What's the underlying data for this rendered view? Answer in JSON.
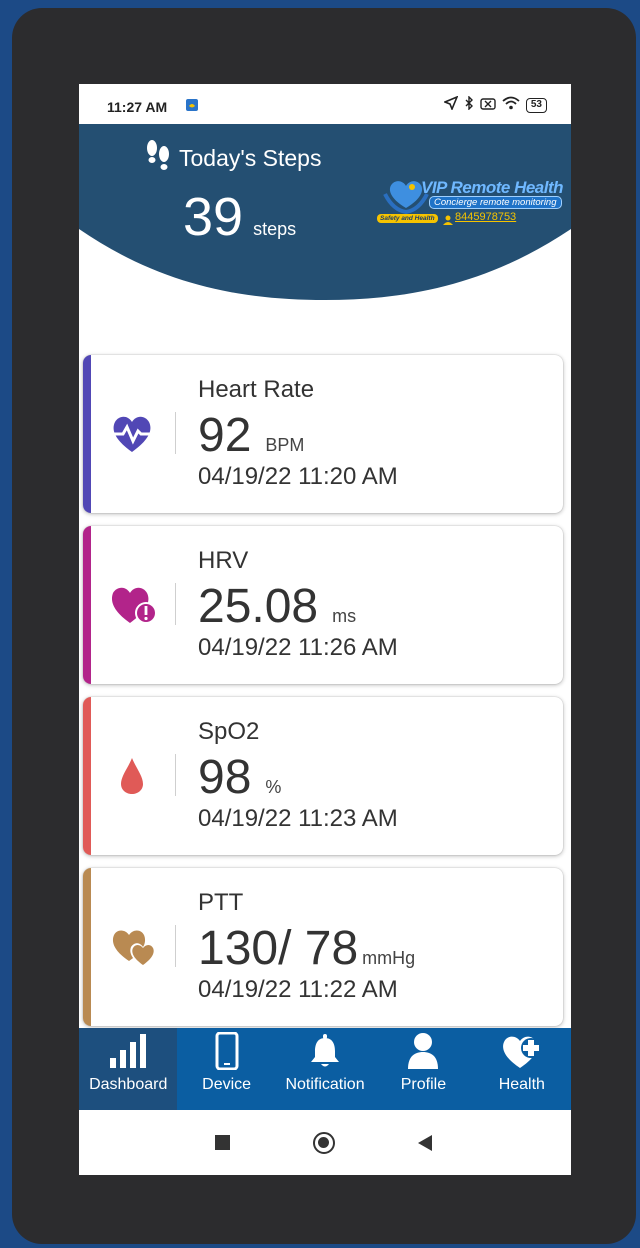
{
  "status_bar": {
    "time": "11:27 AM",
    "battery": "53"
  },
  "header": {
    "steps_title": "Today's Steps",
    "steps_value": "39",
    "steps_unit": "steps",
    "colors": {
      "header_bg": "#244f72"
    }
  },
  "logo": {
    "title": "VIP Remote Health",
    "subtitle": "Concierge remote monitoring",
    "tagline": "Safety and Health",
    "phone": "8445978753"
  },
  "cards": [
    {
      "name": "Heart Rate",
      "value": "92",
      "unit": "BPM",
      "time": "04/19/22 11:20 AM",
      "accent": "#5147b5",
      "icon": "heart-pulse-icon"
    },
    {
      "name": "HRV",
      "value": "25.08",
      "unit": "ms",
      "time": "04/19/22 11:26 AM",
      "accent": "#b2248a",
      "icon": "heart-alert-icon"
    },
    {
      "name": "SpO2",
      "value": "98",
      "unit": "%",
      "time": "04/19/22 11:23 AM",
      "accent": "#e05a57",
      "icon": "blood-drop-icon"
    },
    {
      "name": "PTT",
      "value": "130/ 78",
      "unit": "mmHg",
      "time": "04/19/22 11:22 AM",
      "accent": "#b98a52",
      "icon": "two-hearts-icon"
    }
  ],
  "bottom_nav": [
    {
      "label": "Dashboard",
      "icon": "bar-chart-icon",
      "active": true
    },
    {
      "label": "Device",
      "icon": "phone-icon",
      "active": false
    },
    {
      "label": "Notification",
      "icon": "bell-icon",
      "active": false
    },
    {
      "label": "Profile",
      "icon": "user-icon",
      "active": false
    },
    {
      "label": "Health",
      "icon": "heart-plus-icon",
      "active": false
    }
  ]
}
